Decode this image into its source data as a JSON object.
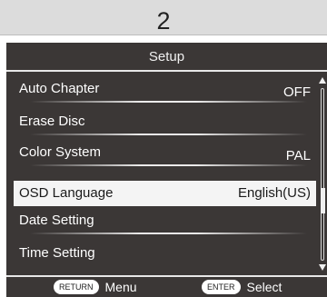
{
  "page_number": "2",
  "screen": {
    "title": "Setup",
    "menu": [
      {
        "label": "Auto Chapter",
        "value": "OFF"
      },
      {
        "label": "Erase Disc",
        "value": ""
      },
      {
        "label": "Color System",
        "value": "PAL"
      },
      {
        "label": "OSD Language",
        "value": "English(US)"
      },
      {
        "label": "Date Setting",
        "value": ""
      },
      {
        "label": "Time Setting",
        "value": ""
      }
    ],
    "selected_index": 3,
    "footer": {
      "return_key": "RETURN",
      "return_action": "Menu",
      "enter_key": "ENTER",
      "enter_action": "Select"
    }
  },
  "colors": {
    "screen_background": "#3b3736",
    "highlight": "#f4f4f4",
    "text": "#ffffff"
  },
  "icons": [
    "scroll-up-arrow-icon",
    "scroll-down-arrow-icon"
  ]
}
